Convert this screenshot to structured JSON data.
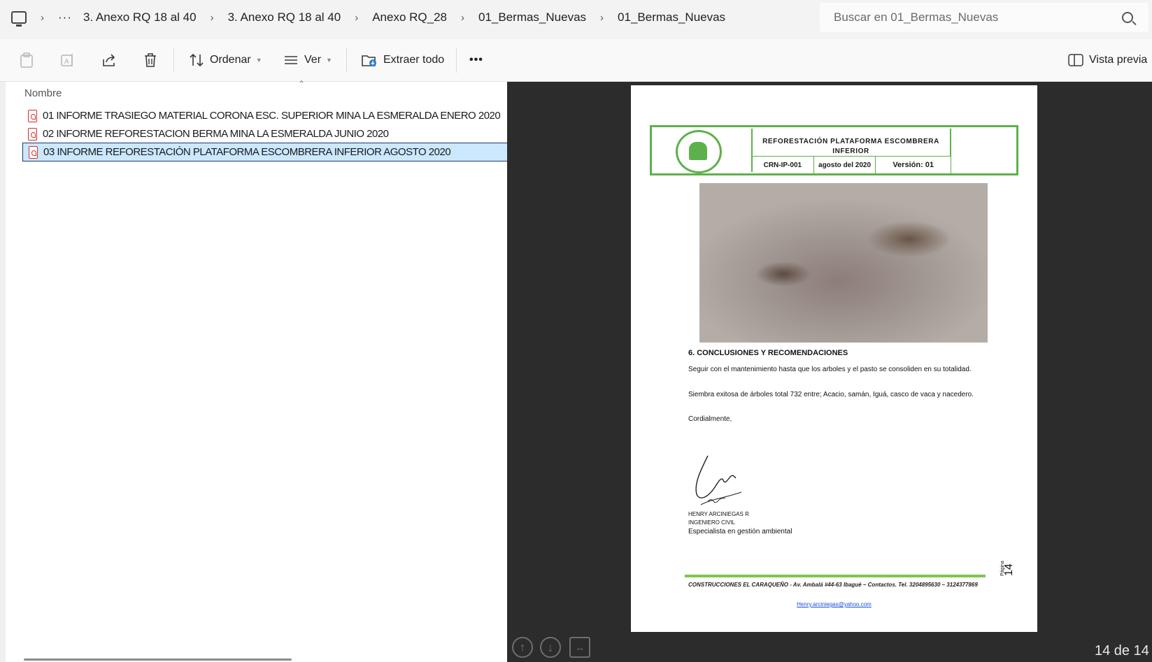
{
  "breadcrumb": {
    "items": [
      "3. Anexo RQ 18 al 40",
      "3. Anexo RQ 18 al 40",
      "Anexo RQ_28",
      "01_Bermas_Nuevas",
      "01_Bermas_Nuevas"
    ]
  },
  "search": {
    "placeholder": "Buscar en 01_Bermas_Nuevas"
  },
  "toolbar": {
    "sort_label": "Ordenar",
    "view_label": "Ver",
    "extract_label": "Extraer todo",
    "more_label": "•••",
    "preview_label": "Vista previa"
  },
  "file_list": {
    "column_name": "Nombre",
    "files": [
      {
        "name": "01 INFORME TRASIEGO MATERIAL CORONA ESC. SUPERIOR MINA LA ESMERALDA ENERO 2020",
        "selected": false
      },
      {
        "name": "02 INFORME  REFORESTACION BERMA MINA  LA ESMERALDA JUNIO 2020",
        "selected": false
      },
      {
        "name": "03 INFORME  REFORESTACIÓN PLATAFORMA ESCOMBRERA INFERIOR AGOSTO 2020",
        "selected": true
      }
    ]
  },
  "document": {
    "header_title": "REFORESTACIÓN  PLATAFORMA ESCOMBRERA INFERIOR",
    "code": "CRN-IP-001",
    "date": "agosto del 2020",
    "version": "Versión: 01",
    "logo_text": "CONSTRUCCIONES EL CARAQUEÑO",
    "section_title": "6. CONCLUSIONES Y RECOMENDACIONES",
    "paragraph1": "Seguir con el mantenimiento hasta que los arboles y el pasto se consoliden en su totalidad.",
    "paragraph2": "Siembra exitosa de árboles total  732 entre; Acacio, samán, Iguá, casco de vaca y nacedero.",
    "closing": "Cordialmente,",
    "signer_name": "HENRY ARCINIEGAS R",
    "signer_title": "INGENIERO CIVIL",
    "signer_specialty": "Especialista en gestión ambiental",
    "page_label": "Página",
    "page_number": "14",
    "footer_text": "CONSTRUCCIONES EL CARAQUEÑO - Av. Ambalá #44-63 Ibagué – Contactos.  Tel. 3204895630 – 3124377869",
    "footer_email": "Henry.arciniegas@yahoo.com"
  },
  "preview_nav": {
    "page_counter": "14 de 14"
  },
  "colors": {
    "selection_bg": "#cce8ff",
    "accent_green": "#5db14a",
    "preview_bg": "#2c2c2c",
    "pdf_red": "#d0312d"
  }
}
